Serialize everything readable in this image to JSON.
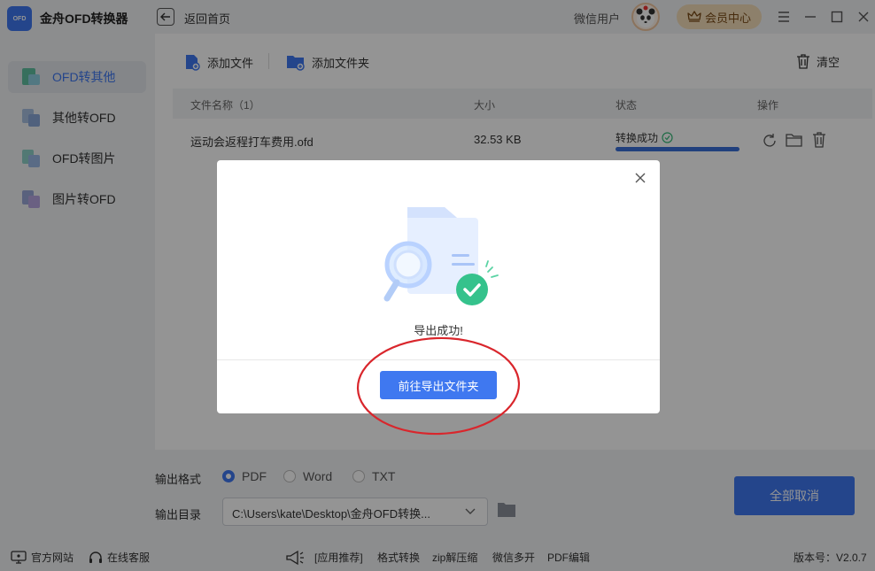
{
  "app": {
    "logo_text": "OFD",
    "title": "金舟OFD转换器"
  },
  "header": {
    "back_label": "返回首页",
    "user_name": "微信用户",
    "vip_label": "会员中心"
  },
  "sidebar": {
    "items": [
      {
        "label": "OFD转其他",
        "icon": "ofd-convert-icon"
      },
      {
        "label": "其他转OFD",
        "icon": "other-to-ofd-icon"
      },
      {
        "label": "OFD转图片",
        "icon": "ofd-to-image-icon"
      },
      {
        "label": "图片转OFD",
        "icon": "image-to-ofd-icon"
      }
    ]
  },
  "toolbar": {
    "add_file": "添加文件",
    "add_folder": "添加文件夹",
    "clear": "清空"
  },
  "table": {
    "columns": [
      "文件名称（1）",
      "大小",
      "状态",
      "操作"
    ],
    "rows": [
      {
        "name": "运动会返程打车费用.ofd",
        "size": "32.53 KB",
        "status": "转换成功",
        "progress": 1.0
      }
    ]
  },
  "modal": {
    "message": "导出成功!",
    "button": "前往导出文件夹"
  },
  "settings": {
    "format_label": "输出格式",
    "formats": [
      "PDF",
      "Word",
      "TXT"
    ],
    "selected_format": "PDF",
    "dir_label": "输出目录",
    "dir_value": "C:\\Users\\kate\\Desktop\\金舟OFD转换..."
  },
  "actions": {
    "cancel_all": "全部取消"
  },
  "footer": {
    "website": "官方网站",
    "support": "在线客服",
    "links": [
      "[应用推荐]",
      "格式转换",
      "zip解压缩",
      "微信多开",
      "PDF编辑"
    ],
    "version": "版本号：V2.0.7"
  },
  "colors": {
    "accent": "#3f78f0",
    "annotation": "#d9262c",
    "success": "#35b878"
  }
}
